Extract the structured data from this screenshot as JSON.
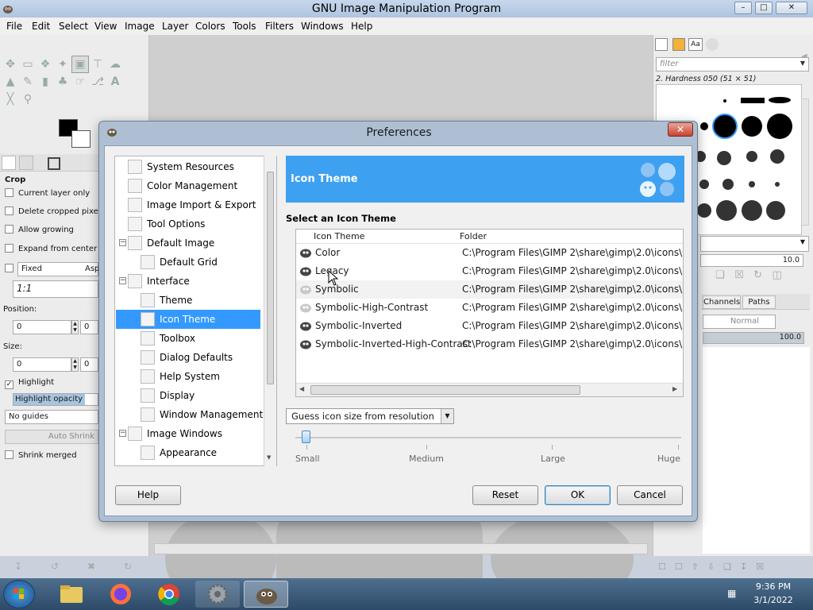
{
  "window": {
    "title": "GNU Image Manipulation Program",
    "min_label": "–",
    "max_label": "□",
    "close_label": "✕"
  },
  "menu": [
    "File",
    "Edit",
    "Select",
    "View",
    "Image",
    "Layer",
    "Colors",
    "Tools",
    "Filters",
    "Windows",
    "Help"
  ],
  "tool_options": {
    "title": "Crop",
    "current_layer_only": "Current layer only",
    "delete_cropped": "Delete cropped pixels",
    "allow_growing": "Allow growing",
    "expand_from_center": "Expand from center",
    "fixed": "Fixed",
    "aspect": "Aspe",
    "ratio": "1:1",
    "position_label": "Position:",
    "pos_x": "0",
    "pos_y": "0",
    "size_label": "Size:",
    "size_x": "0",
    "size_y": "0",
    "highlight": "Highlight",
    "highlight_opacity": "Highlight opacity",
    "guides": "No guides",
    "auto_shrink": "Auto Shrink",
    "shrink_merged": "Shrink merged"
  },
  "brushes": {
    "filter_placeholder": "filter",
    "brush_name": "2. Hardness 050 (51 × 51)",
    "spacing": "10.0",
    "tab_channels": "Channels",
    "tab_paths": "Paths",
    "mode": "Normal",
    "opacity": "100.0"
  },
  "dialog": {
    "title": "Preferences",
    "close_label": "✕",
    "nav": [
      {
        "label": "System Resources",
        "level": 1,
        "expander": ""
      },
      {
        "label": "Color Management",
        "level": 1,
        "expander": ""
      },
      {
        "label": "Image Import & Export",
        "level": 1,
        "expander": ""
      },
      {
        "label": "Tool Options",
        "level": 1,
        "expander": ""
      },
      {
        "label": "Default Image",
        "level": 1,
        "expander": "−"
      },
      {
        "label": "Default Grid",
        "level": 2,
        "expander": ""
      },
      {
        "label": "Interface",
        "level": 1,
        "expander": "−"
      },
      {
        "label": "Theme",
        "level": 2,
        "expander": ""
      },
      {
        "label": "Icon Theme",
        "level": 2,
        "expander": "",
        "selected": true
      },
      {
        "label": "Toolbox",
        "level": 2,
        "expander": ""
      },
      {
        "label": "Dialog Defaults",
        "level": 2,
        "expander": ""
      },
      {
        "label": "Help System",
        "level": 2,
        "expander": ""
      },
      {
        "label": "Display",
        "level": 2,
        "expander": ""
      },
      {
        "label": "Window Management",
        "level": 2,
        "expander": ""
      },
      {
        "label": "Image Windows",
        "level": 1,
        "expander": "−"
      },
      {
        "label": "Appearance",
        "level": 2,
        "expander": ""
      }
    ],
    "banner_title": "Icon Theme",
    "section_label": "Select an Icon Theme",
    "columns": {
      "name": "Icon Theme",
      "folder": "Folder"
    },
    "themes": [
      {
        "name": "Color",
        "folder": "C:\\Program Files\\GIMP 2\\share\\gimp\\2.0\\icons\\Colo"
      },
      {
        "name": "Legacy",
        "folder": "C:\\Program Files\\GIMP 2\\share\\gimp\\2.0\\icons\\Lega"
      },
      {
        "name": "Symbolic",
        "folder": "C:\\Program Files\\GIMP 2\\share\\gimp\\2.0\\icons\\Symb"
      },
      {
        "name": "Symbolic-High-Contrast",
        "folder": "C:\\Program Files\\GIMP 2\\share\\gimp\\2.0\\icons\\Symb"
      },
      {
        "name": "Symbolic-Inverted",
        "folder": "C:\\Program Files\\GIMP 2\\share\\gimp\\2.0\\icons\\Symb"
      },
      {
        "name": "Symbolic-Inverted-High-Contrast",
        "folder": "C:\\Program Files\\GIMP 2\\share\\gimp\\2.0\\icons\\Symb"
      }
    ],
    "icon_size_mode": "Guess icon size from resolution",
    "size_labels": [
      "Small",
      "Medium",
      "Large",
      "Huge"
    ],
    "size_value": 0,
    "buttons": {
      "help": "Help",
      "reset": "Reset",
      "ok": "OK",
      "cancel": "Cancel"
    }
  },
  "taskbar": {
    "time": "9:36 PM",
    "date": "3/1/2022"
  },
  "colors": {
    "accent": "#3399ff",
    "banner": "#3ea0f0"
  }
}
